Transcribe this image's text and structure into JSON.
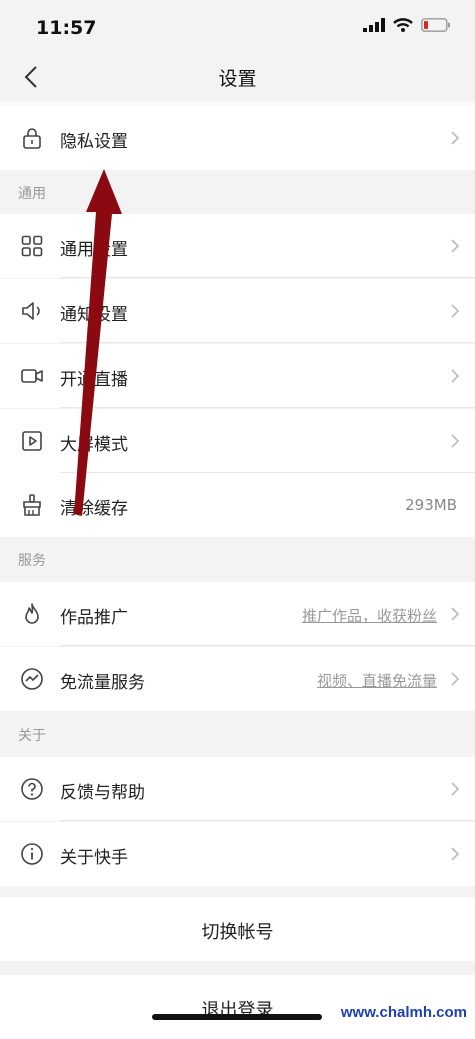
{
  "status_bar": {
    "time": "11:57",
    "battery_color": "#e0241b"
  },
  "nav": {
    "title": "设置"
  },
  "rows": {
    "privacy": {
      "label": "隐私设置"
    },
    "general_settings": {
      "label": "通用设置"
    },
    "notification_settings": {
      "label": "通知设置"
    },
    "live": {
      "label": "开通直播"
    },
    "large_screen": {
      "label": "大屏模式"
    },
    "clear_cache": {
      "label": "清除缓存",
      "value": "293MB"
    },
    "promotion": {
      "label": "作品推广",
      "value": "推广作品，收获粉丝"
    },
    "free_data": {
      "label": "免流量服务",
      "value": "视频、直播免流量"
    },
    "feedback": {
      "label": "反馈与帮助"
    },
    "about_app": {
      "label": "关于快手"
    }
  },
  "sections": {
    "general": "通用",
    "services": "服务",
    "about": "关于"
  },
  "actions": {
    "switch_account": "切换帐号",
    "logout": "退出登录"
  },
  "overlay": {
    "arrow_color": "#8b0a12"
  },
  "watermark": {
    "text": "www.chalmh.com"
  }
}
